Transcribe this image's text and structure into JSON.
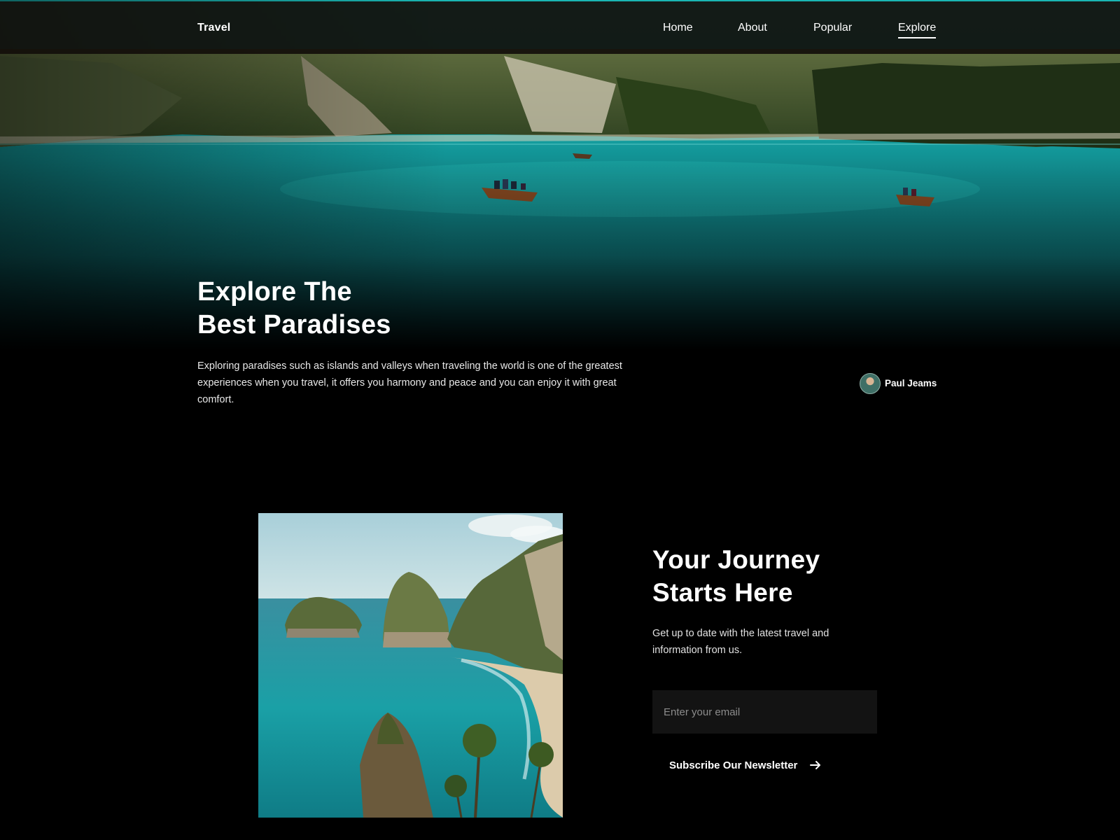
{
  "navbar": {
    "logo": "Travel",
    "links": [
      {
        "label": "Home"
      },
      {
        "label": "About"
      },
      {
        "label": "Popular"
      },
      {
        "label": "Explore",
        "active": true
      }
    ]
  },
  "hero": {
    "title_line1": "Explore The",
    "title_line2": "Best Paradises",
    "description": "Exploring paradises such as islands and valleys when traveling the world is one of the greatest experiences when you travel, it offers you harmony and peace and you can enjoy it with great comfort.",
    "author": "Paul Jeams"
  },
  "newsletter": {
    "title_line1": "Your Journey",
    "title_line2": "Starts Here",
    "description": "Get up to date with the latest travel and information from us.",
    "email_placeholder": "Enter your email",
    "subscribe_label": "Subscribe Our Newsletter",
    "subscribe_icon": "arrow-right-icon"
  },
  "colors": {
    "background": "#000000",
    "lake": "#1aa5a6",
    "accent_line": "#8a1c24"
  }
}
